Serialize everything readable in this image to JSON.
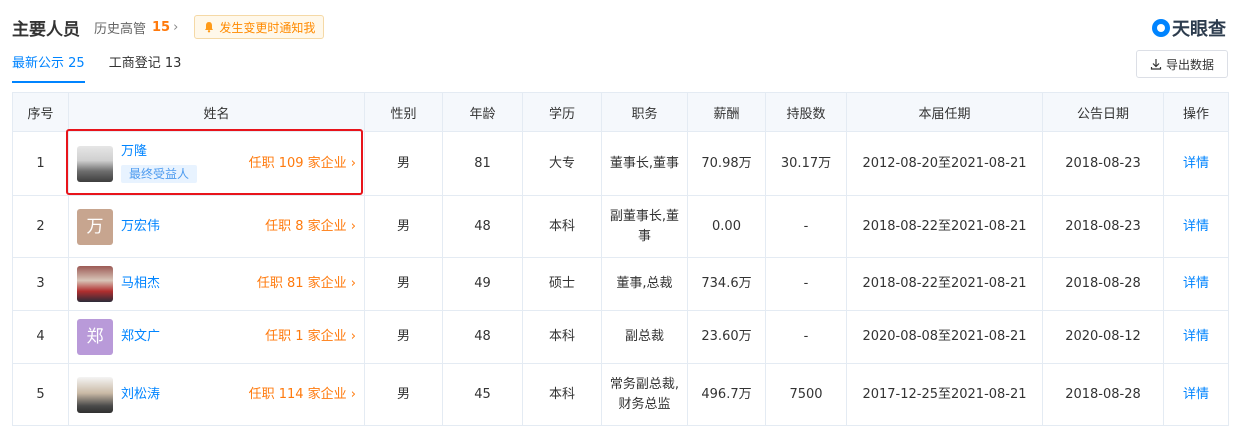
{
  "header": {
    "title": "主要人员",
    "history_label": "历史高管",
    "history_count": "15",
    "notify_label": "发生变更时通知我"
  },
  "logo": {
    "text": "天眼查"
  },
  "tabs": [
    {
      "label": "最新公示 25"
    },
    {
      "label": "工商登记 13"
    }
  ],
  "export_label": "导出数据",
  "table": {
    "headers": [
      "序号",
      "姓名",
      "性别",
      "年龄",
      "学历",
      "职务",
      "薪酬",
      "持股数",
      "本届任期",
      "公告日期",
      "操作"
    ],
    "rows": [
      {
        "idx": "1",
        "name": "万隆",
        "badge": "最终受益人",
        "posts": "任职 109 家企业",
        "gender": "男",
        "age": "81",
        "edu": "大专",
        "role": "董事长,董事",
        "salary": "70.98万",
        "shares": "30.17万",
        "term": "2012-08-20至2021-08-21",
        "date": "2018-08-23",
        "action": "详情"
      },
      {
        "idx": "2",
        "name": "万宏伟",
        "avatar_char": "万",
        "posts": "任职 8 家企业",
        "gender": "男",
        "age": "48",
        "edu": "本科",
        "role_line1": "副董事长,董",
        "role_line2": "事",
        "salary": "0.00",
        "shares": "-",
        "term": "2018-08-22至2021-08-21",
        "date": "2018-08-23",
        "action": "详情"
      },
      {
        "idx": "3",
        "name": "马相杰",
        "posts": "任职 81 家企业",
        "gender": "男",
        "age": "49",
        "edu": "硕士",
        "role": "董事,总裁",
        "salary": "734.6万",
        "shares": "-",
        "term": "2018-08-22至2021-08-21",
        "date": "2018-08-28",
        "action": "详情"
      },
      {
        "idx": "4",
        "name": "郑文广",
        "avatar_char": "郑",
        "posts": "任职 1 家企业",
        "gender": "男",
        "age": "48",
        "edu": "本科",
        "role": "副总裁",
        "salary": "23.60万",
        "shares": "-",
        "term": "2020-08-08至2021-08-21",
        "date": "2020-08-12",
        "action": "详情"
      },
      {
        "idx": "5",
        "name": "刘松涛",
        "posts": "任职 114 家企业",
        "gender": "男",
        "age": "45",
        "edu": "本科",
        "role_line1": "常务副总裁,",
        "role_line2": "财务总监",
        "salary": "496.7万",
        "shares": "7500",
        "term": "2017-12-25至2021-08-21",
        "date": "2018-08-28",
        "action": "详情"
      }
    ]
  }
}
